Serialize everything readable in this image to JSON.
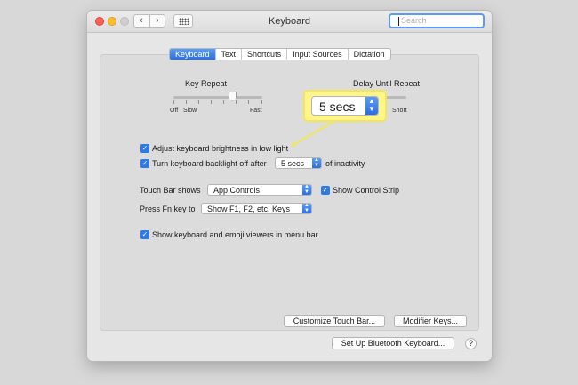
{
  "window": {
    "title": "Keyboard",
    "search_placeholder": "Search"
  },
  "icons": {
    "back": "chevron-left-icon",
    "forward": "chevron-right-icon",
    "grid": "grid-icon",
    "search": "search-icon",
    "checkmark": "checkmark-icon",
    "popup_arrows": "updown-arrows-icon"
  },
  "tabs": [
    {
      "label": "Keyboard",
      "active": true
    },
    {
      "label": "Text",
      "active": false
    },
    {
      "label": "Shortcuts",
      "active": false
    },
    {
      "label": "Input Sources",
      "active": false
    },
    {
      "label": "Dictation",
      "active": false
    }
  ],
  "key_repeat": {
    "title": "Key Repeat",
    "left_labels": [
      "Off",
      "Slow"
    ],
    "right_label": "Fast"
  },
  "delay_until_repeat": {
    "title": "Delay Until Repeat",
    "right_label": "Short"
  },
  "options": {
    "brightness": {
      "label": "Adjust keyboard brightness in low light",
      "checked": true
    },
    "backlight": {
      "label": "Turn keyboard backlight off after",
      "checked": true,
      "value": "5 secs",
      "suffix": "of inactivity"
    },
    "touch_bar": {
      "label": "Touch Bar shows",
      "value": "App Controls"
    },
    "control_strip": {
      "label": "Show Control Strip",
      "checked": true
    },
    "fn_key": {
      "label": "Press Fn key to",
      "value": "Show F1, F2, etc. Keys"
    },
    "emoji_viewers": {
      "label": "Show keyboard and emoji viewers in menu bar",
      "checked": true
    }
  },
  "buttons": {
    "customize_touch_bar": "Customize Touch Bar...",
    "modifier_keys": "Modifier Keys...",
    "bluetooth_keyboard": "Set Up Bluetooth Keyboard...",
    "help": "?"
  },
  "callout": {
    "value": "5 secs",
    "color": "#fff58a"
  }
}
